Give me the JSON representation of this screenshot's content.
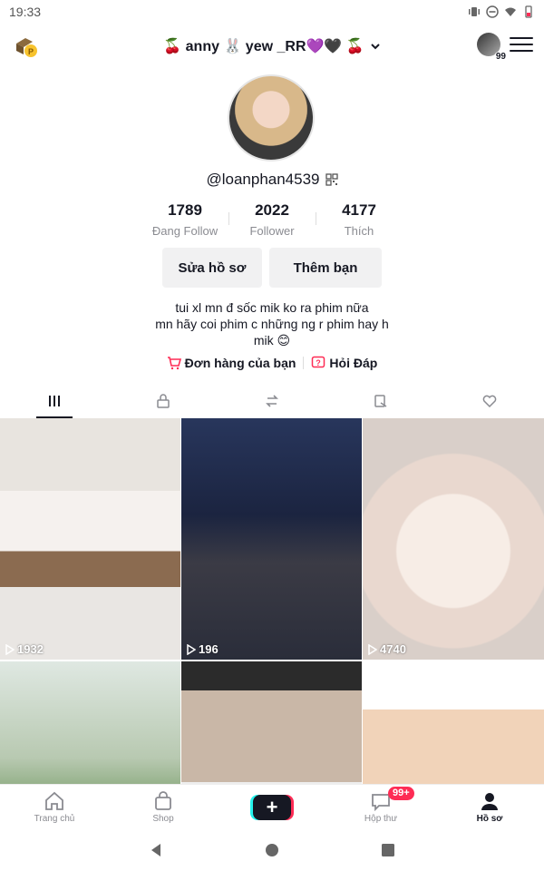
{
  "status_bar": {
    "time": "19:33"
  },
  "header": {
    "username_display": "🍒 anny 🐰 yew _RR💜🖤 🍒",
    "friends_count": "99"
  },
  "profile": {
    "handle": "@loanphan4539",
    "stats": [
      {
        "value": "1789",
        "label": "Đang Follow"
      },
      {
        "value": "2022",
        "label": "Follower"
      },
      {
        "value": "4177",
        "label": "Thích"
      }
    ],
    "edit_label": "Sửa hồ sơ",
    "add_friend_label": "Thêm bạn",
    "bio_lines": [
      "tui xl mn đ sốc mik ko ra phim nữa",
      "mn hãy coi phim c những ng r phim hay h",
      "mik 😊"
    ],
    "orders_link": "Đơn hàng của bạn",
    "qa_link": "Hỏi Đáp"
  },
  "videos": [
    {
      "views": "1932"
    },
    {
      "views": "196"
    },
    {
      "views": "4740"
    },
    {
      "views": ""
    },
    {
      "views": ""
    },
    {
      "views": ""
    }
  ],
  "bottom_nav": {
    "home": "Trang chủ",
    "shop": "Shop",
    "create": "+",
    "inbox": "Hộp thư",
    "inbox_badge": "99+",
    "profile": "Hồ sơ"
  },
  "colors": {
    "accent": "#fe2c55",
    "cyan": "#25f4ee",
    "text": "#161823",
    "muted": "#8a8b91"
  }
}
